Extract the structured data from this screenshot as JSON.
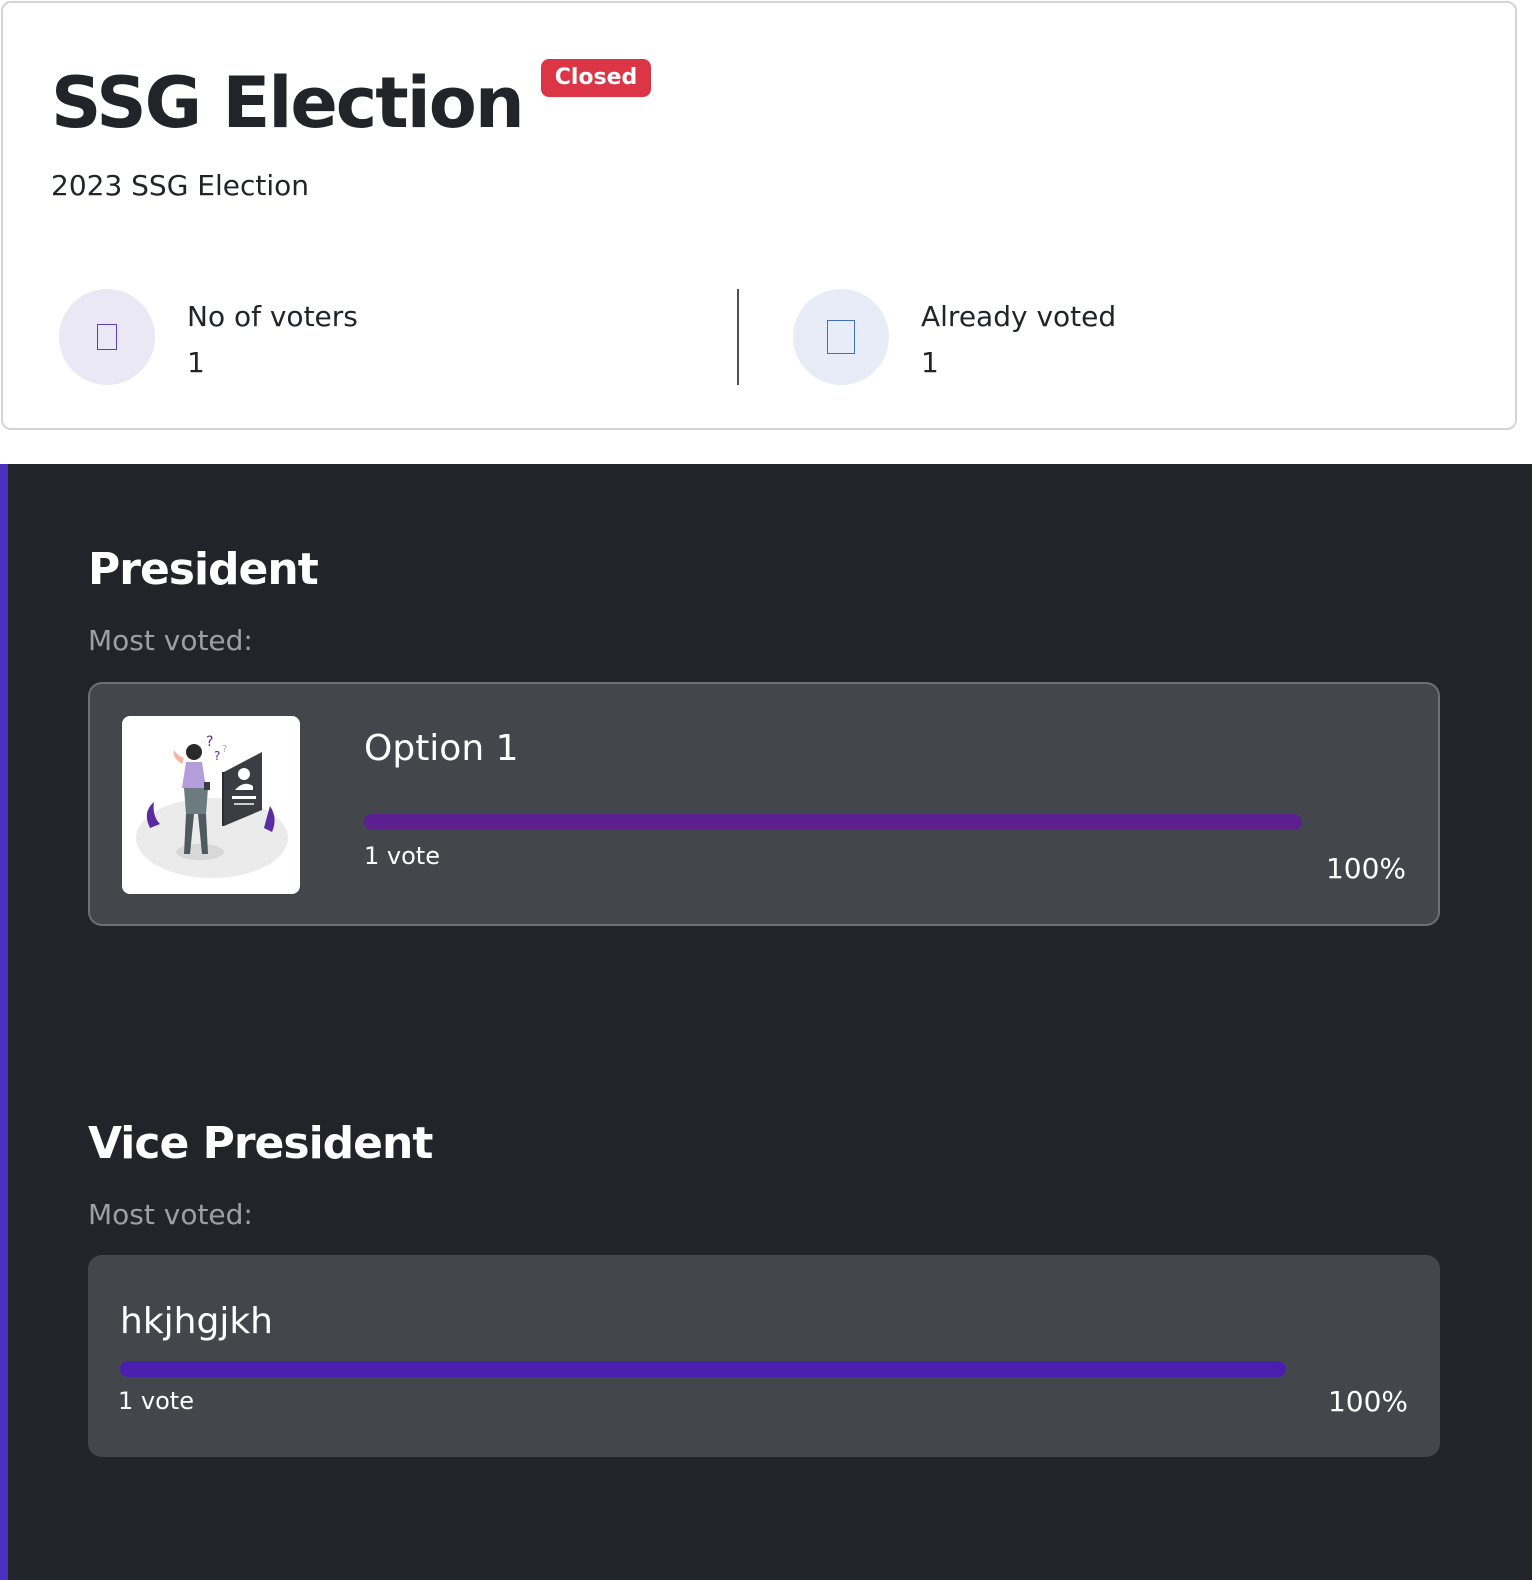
{
  "election": {
    "title": "SSG Election",
    "status": "Closed",
    "description": "2023 SSG Election"
  },
  "stats": {
    "voters": {
      "label": "No of voters",
      "value": "1",
      "icon": "users-icon"
    },
    "voted": {
      "label": "Already voted",
      "value": "1",
      "icon": "ballot-icon"
    }
  },
  "positions": [
    {
      "title": "President",
      "most_voted_label": "Most voted:",
      "candidate": {
        "name": "Option 1",
        "votes_text": "1 vote",
        "percent_text": "100%",
        "share": 1.0,
        "bar_color": "#5b1f8f",
        "image": "candidate-illustration"
      }
    },
    {
      "title": "Vice President",
      "most_voted_label": "Most voted:",
      "candidate": {
        "name": "hkjhgjkh",
        "votes_text": "1 vote",
        "percent_text": "100%",
        "share": 1.0,
        "bar_color": "#4a1fb0"
      }
    }
  ],
  "colors": {
    "closed_badge": "#dc3545",
    "results_background": "#212428",
    "card_background": "#43474b",
    "accent": "#4b2fbd"
  }
}
